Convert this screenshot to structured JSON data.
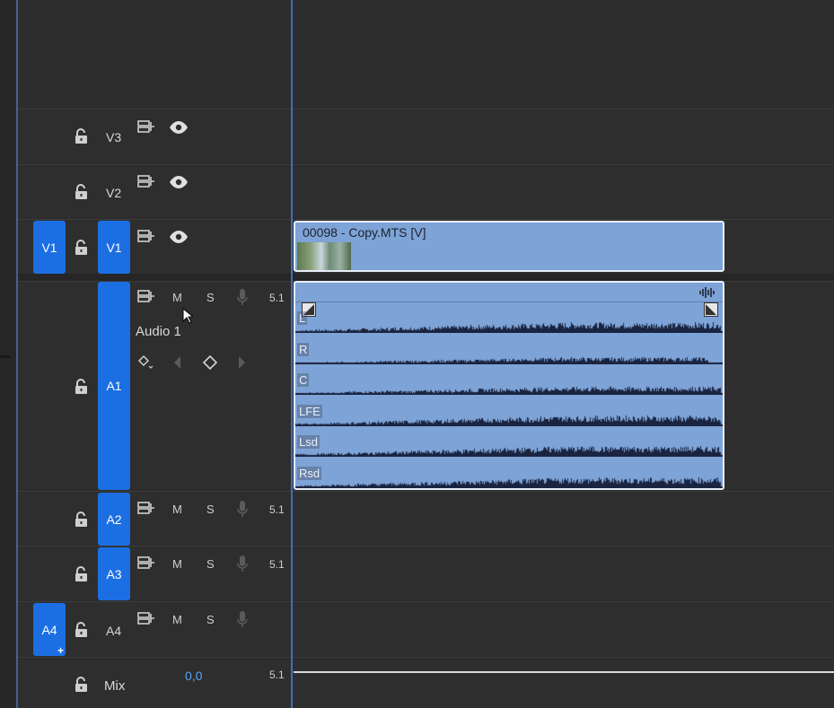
{
  "tracks": {
    "v3": {
      "label": "V3"
    },
    "v2": {
      "label": "V2"
    },
    "v1": {
      "source_patch": "V1",
      "label": "V1"
    },
    "a1": {
      "label": "A1",
      "name": "Audio 1",
      "mute": "M",
      "solo": "S",
      "channels": "5.1"
    },
    "a2": {
      "label": "A2",
      "mute": "M",
      "solo": "S",
      "channels": "5.1"
    },
    "a3": {
      "label": "A3",
      "mute": "M",
      "solo": "S",
      "channels": "5.1"
    },
    "a4": {
      "source_patch": "A4",
      "label": "A4",
      "mute": "M",
      "solo": "S"
    },
    "mix": {
      "label": "Mix",
      "value": "0,0",
      "channels": "5.1"
    }
  },
  "clips": {
    "video": {
      "name": "00098 - Copy.MTS [V]"
    },
    "audio": {
      "channels": [
        "L",
        "R",
        "C",
        "LFE",
        "Lsd",
        "Rsd"
      ]
    }
  },
  "colors": {
    "accent": "#1c6fe3",
    "clip": "#7ea3d6",
    "waveform": "#1a2440",
    "mix_value": "#5aa2ff"
  },
  "icons": {
    "lock": "lock-open-icon",
    "sync": "sync-lock-icon",
    "eye": "eye-icon",
    "mic": "microphone-icon",
    "keyframe": "keyframe-diamond-icon",
    "prev": "prev-keyframe-icon",
    "next": "next-keyframe-icon",
    "waveform": "waveform-icon"
  }
}
